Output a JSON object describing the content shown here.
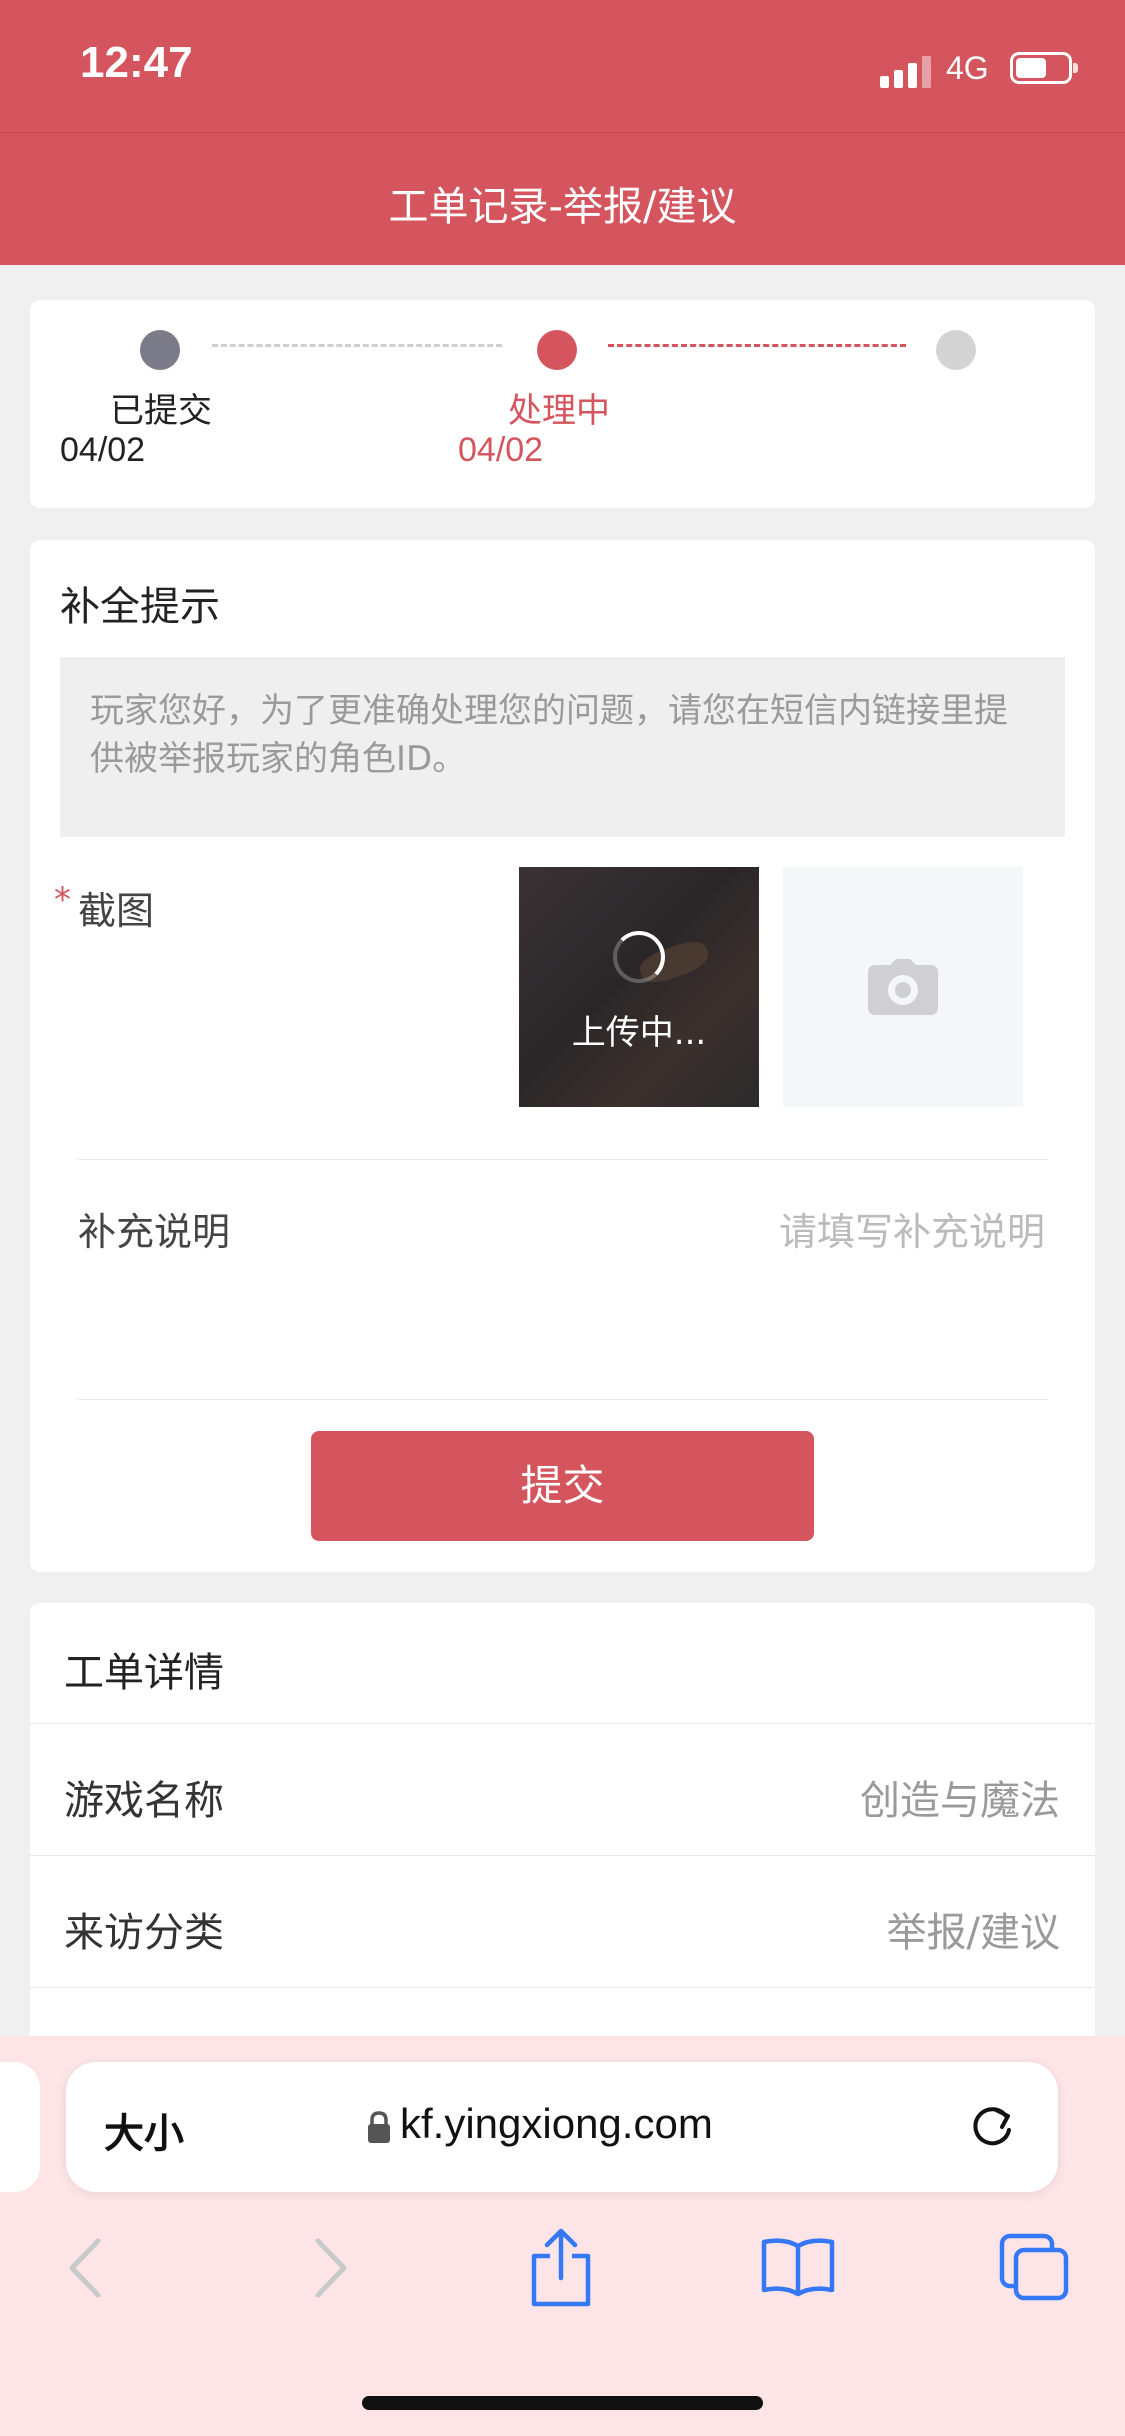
{
  "status_bar": {
    "time": "12:47",
    "network": "4G"
  },
  "header": {
    "title": "工单记录-举报/建议"
  },
  "progress": {
    "steps": [
      {
        "label": "已提交",
        "date": "04/02",
        "color": "#7b7b8a"
      },
      {
        "label": "处理中",
        "date": "04/02",
        "color": "#d4555d"
      },
      {
        "label": "",
        "date": "",
        "color": "#d3d3d3"
      }
    ]
  },
  "supplement": {
    "title": "补全提示",
    "tip": "玩家您好，为了更准确处理您的问题，请您在短信内链接里提供被举报玩家的角色ID。",
    "required_mark": "*",
    "screenshot_label": "截图",
    "uploading_text": "上传中...",
    "note_label": "补充说明",
    "note_placeholder": "请填写补充说明",
    "submit_label": "提交"
  },
  "details": {
    "title": "工单详情",
    "rows": [
      {
        "label": "游戏名称",
        "value": "创造与魔法"
      },
      {
        "label": "来访分类",
        "value": "举报/建议"
      }
    ]
  },
  "browser": {
    "text_size_label": "大小",
    "url": "kf.yingxiong.com"
  },
  "colors": {
    "brand": "#d4555d",
    "browser_bar": "#fde4e6",
    "ios_blue": "#3478f6"
  }
}
